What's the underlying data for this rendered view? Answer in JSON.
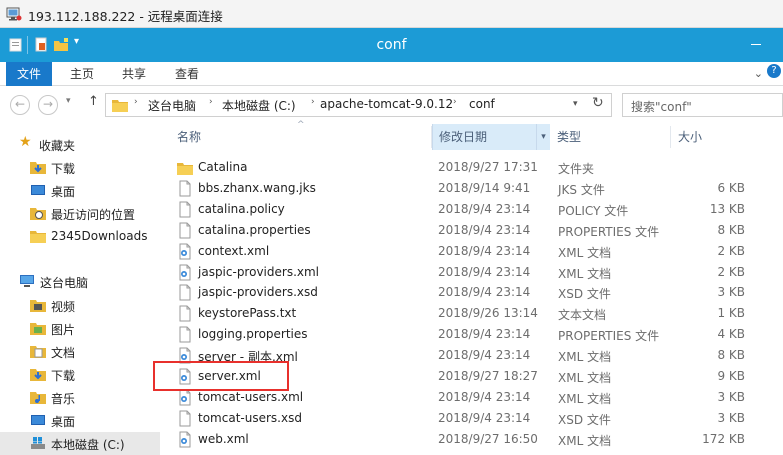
{
  "rdp": {
    "title": "193.112.188.222 - 远程桌面连接"
  },
  "window": {
    "title": "conf"
  },
  "ribbon": {
    "tabs": [
      {
        "label": "文件"
      },
      {
        "label": "主页"
      },
      {
        "label": "共享"
      },
      {
        "label": "查看"
      }
    ]
  },
  "address": {
    "crumbs": [
      "这台电脑",
      "本地磁盘 (C:)",
      "apache-tomcat-9.0.12",
      "conf"
    ],
    "refresh_icon": "refresh-icon"
  },
  "search": {
    "placeholder": "搜索\"conf\""
  },
  "nav": {
    "favorites": {
      "label": "收藏夹",
      "items": [
        {
          "label": "下载",
          "icon": "download-folder-icon"
        },
        {
          "label": "桌面",
          "icon": "desktop-icon"
        },
        {
          "label": "最近访问的位置",
          "icon": "recent-places-icon"
        },
        {
          "label": "2345Downloads",
          "icon": "folder-icon"
        }
      ]
    },
    "thispc": {
      "label": "这台电脑",
      "items": [
        {
          "label": "视频",
          "icon": "video-folder-icon"
        },
        {
          "label": "图片",
          "icon": "pictures-folder-icon"
        },
        {
          "label": "文档",
          "icon": "documents-folder-icon"
        },
        {
          "label": "下载",
          "icon": "download-folder-icon"
        },
        {
          "label": "音乐",
          "icon": "music-folder-icon"
        },
        {
          "label": "桌面",
          "icon": "desktop-icon"
        },
        {
          "label": "本地磁盘 (C:)",
          "icon": "drive-icon",
          "selected": true
        }
      ]
    }
  },
  "columns": {
    "name": "名称",
    "modified": "修改日期",
    "type": "类型",
    "size": "大小"
  },
  "files": [
    {
      "name": "Catalina",
      "date": "2018/9/27 17:31",
      "type": "文件夹",
      "size": "",
      "icon": "folder"
    },
    {
      "name": "bbs.zhanx.wang.jks",
      "date": "2018/9/14 9:41",
      "type": "JKS 文件",
      "size": "6 KB",
      "icon": "file"
    },
    {
      "name": "catalina.policy",
      "date": "2018/9/4 23:14",
      "type": "POLICY 文件",
      "size": "13 KB",
      "icon": "file"
    },
    {
      "name": "catalina.properties",
      "date": "2018/9/4 23:14",
      "type": "PROPERTIES 文件",
      "size": "8 KB",
      "icon": "file"
    },
    {
      "name": "context.xml",
      "date": "2018/9/4 23:14",
      "type": "XML 文档",
      "size": "2 KB",
      "icon": "xml"
    },
    {
      "name": "jaspic-providers.xml",
      "date": "2018/9/4 23:14",
      "type": "XML 文档",
      "size": "2 KB",
      "icon": "xml"
    },
    {
      "name": "jaspic-providers.xsd",
      "date": "2018/9/4 23:14",
      "type": "XSD 文件",
      "size": "3 KB",
      "icon": "file"
    },
    {
      "name": "keystorePass.txt",
      "date": "2018/9/26 13:14",
      "type": "文本文档",
      "size": "1 KB",
      "icon": "file"
    },
    {
      "name": "logging.properties",
      "date": "2018/9/4 23:14",
      "type": "PROPERTIES 文件",
      "size": "4 KB",
      "icon": "file"
    },
    {
      "name": "server - 副本.xml",
      "date": "2018/9/4 23:14",
      "type": "XML 文档",
      "size": "8 KB",
      "icon": "xml"
    },
    {
      "name": "server.xml",
      "date": "2018/9/27 18:27",
      "type": "XML 文档",
      "size": "9 KB",
      "icon": "xml"
    },
    {
      "name": "tomcat-users.xml",
      "date": "2018/9/4 23:14",
      "type": "XML 文档",
      "size": "3 KB",
      "icon": "xml"
    },
    {
      "name": "tomcat-users.xsd",
      "date": "2018/9/4 23:14",
      "type": "XSD 文件",
      "size": "3 KB",
      "icon": "file"
    },
    {
      "name": "web.xml",
      "date": "2018/9/27 16:50",
      "type": "XML 文档",
      "size": "172 KB",
      "icon": "xml"
    }
  ],
  "colors": {
    "titlebar": "#1c9bd6",
    "file_tab": "#1979ca",
    "highlight": "#e8302c"
  }
}
